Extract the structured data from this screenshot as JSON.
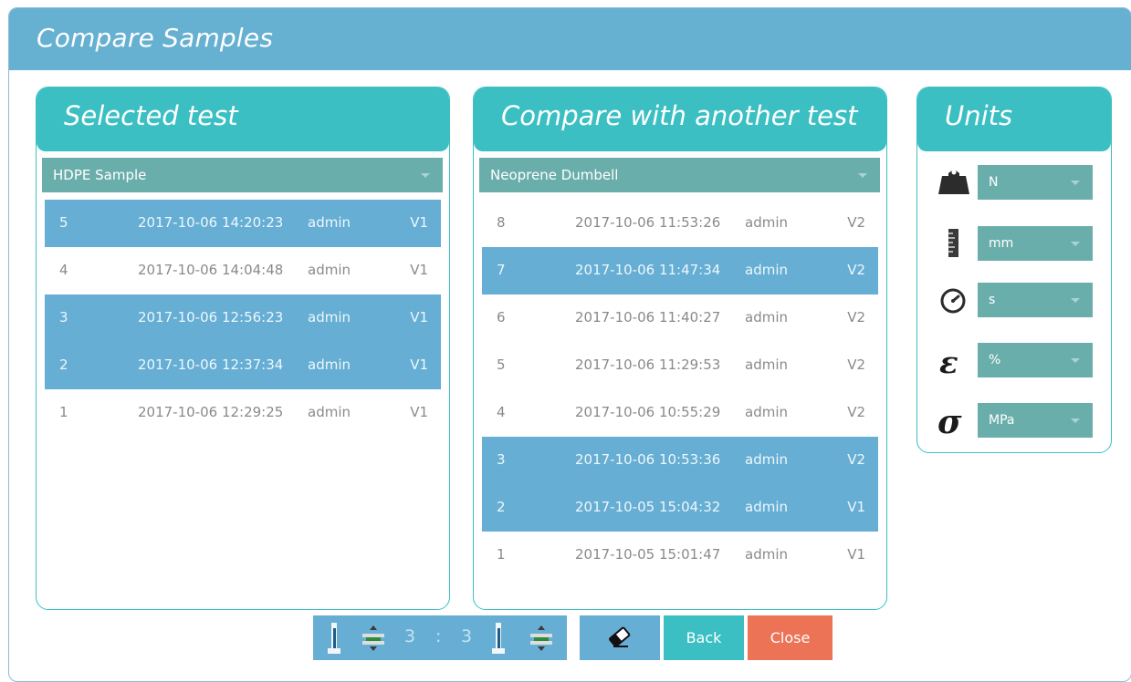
{
  "window": {
    "title": "Compare Samples"
  },
  "selected_panel": {
    "title": "Selected test",
    "dropdown_value": "HDPE Sample",
    "rows": [
      {
        "id": "5",
        "date": "2017-10-06 14:20:23",
        "user": "admin",
        "version": "V1",
        "selected": true
      },
      {
        "id": "4",
        "date": "2017-10-06 14:04:48",
        "user": "admin",
        "version": "V1",
        "selected": false
      },
      {
        "id": "3",
        "date": "2017-10-06 12:56:23",
        "user": "admin",
        "version": "V1",
        "selected": true
      },
      {
        "id": "2",
        "date": "2017-10-06 12:37:34",
        "user": "admin",
        "version": "V1",
        "selected": true
      },
      {
        "id": "1",
        "date": "2017-10-06 12:29:25",
        "user": "admin",
        "version": "V1",
        "selected": false
      }
    ]
  },
  "compare_panel": {
    "title": "Compare with another test",
    "dropdown_value": "Neoprene Dumbell",
    "rows": [
      {
        "id": "8",
        "date": "2017-10-06 11:53:26",
        "user": "admin",
        "version": "V2",
        "selected": false
      },
      {
        "id": "7",
        "date": "2017-10-06 11:47:34",
        "user": "admin",
        "version": "V2",
        "selected": true
      },
      {
        "id": "6",
        "date": "2017-10-06 11:40:27",
        "user": "admin",
        "version": "V2",
        "selected": false
      },
      {
        "id": "5",
        "date": "2017-10-06 11:29:53",
        "user": "admin",
        "version": "V2",
        "selected": false
      },
      {
        "id": "4",
        "date": "2017-10-06 10:55:29",
        "user": "admin",
        "version": "V2",
        "selected": false
      },
      {
        "id": "3",
        "date": "2017-10-06 10:53:36",
        "user": "admin",
        "version": "V2",
        "selected": true
      },
      {
        "id": "2",
        "date": "2017-10-05 15:04:32",
        "user": "admin",
        "version": "V1",
        "selected": true
      },
      {
        "id": "1",
        "date": "2017-10-05 15:01:47",
        "user": "admin",
        "version": "V1",
        "selected": false
      }
    ]
  },
  "units_panel": {
    "title": "Units",
    "items": [
      {
        "icon": "weight-icon",
        "value": "N"
      },
      {
        "icon": "ruler-icon",
        "value": "mm"
      },
      {
        "icon": "stopwatch-icon",
        "value": "s"
      },
      {
        "icon": "strain-epsilon-icon",
        "value": "%"
      },
      {
        "icon": "stress-sigma-icon",
        "value": "MPa"
      }
    ]
  },
  "footer": {
    "count_left": "3",
    "separator": ":",
    "count_right": "3",
    "back_label": "Back",
    "close_label": "Close"
  },
  "colors": {
    "title_bar": "#66b0d2",
    "panel_accent": "#3bbfc2",
    "dropdown": "#6aaeab",
    "selected_row": "#66aed3",
    "close_button": "#ec7356"
  }
}
